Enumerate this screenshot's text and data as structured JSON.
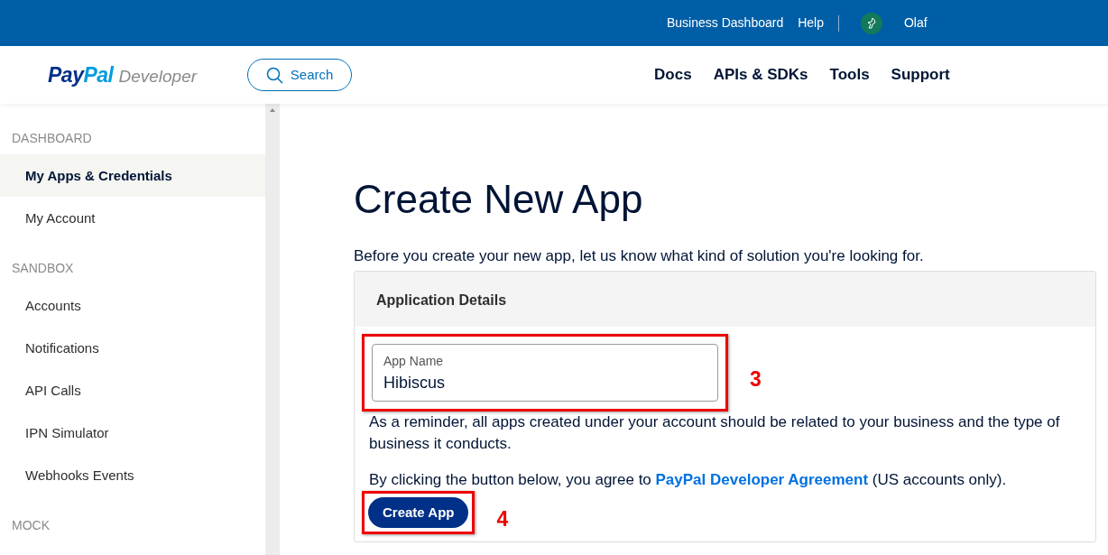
{
  "top_bar": {
    "links": [
      "Business Dashboard",
      "Help"
    ],
    "user": "Olaf"
  },
  "header": {
    "logo": {
      "brand_dark": "Pay",
      "brand_light": "Pal",
      "product": "Developer"
    },
    "search": "Search",
    "nav": [
      "Docs",
      "APIs & SDKs",
      "Tools",
      "Support"
    ]
  },
  "sidebar": {
    "sections": [
      {
        "title": "DASHBOARD",
        "items": [
          {
            "label": "My Apps & Credentials",
            "selected": true
          },
          {
            "label": "My Account",
            "selected": false
          }
        ]
      },
      {
        "title": "SANDBOX",
        "items": [
          {
            "label": "Accounts",
            "selected": false
          },
          {
            "label": "Notifications",
            "selected": false
          },
          {
            "label": "API Calls",
            "selected": false
          },
          {
            "label": "IPN Simulator",
            "selected": false
          },
          {
            "label": "Webhooks Events",
            "selected": false
          }
        ]
      },
      {
        "title": "MOCK"
      }
    ]
  },
  "main": {
    "title": "Create New App",
    "intro": "Before you create your new app, let us know what kind of solution you're looking for.",
    "card": {
      "header": "Application Details",
      "field": {
        "label": "App Name",
        "value": "Hibiscus",
        "annotation": "3"
      },
      "reminder": "As a reminder, all apps created under your account should be related to your business and the type of business it conducts.",
      "agreement": {
        "before": "By clicking the button below, you agree to ",
        "link": "PayPal Developer Agreement",
        "after": " (US accounts only)."
      },
      "button": {
        "label": "Create App",
        "annotation": "4"
      }
    }
  }
}
